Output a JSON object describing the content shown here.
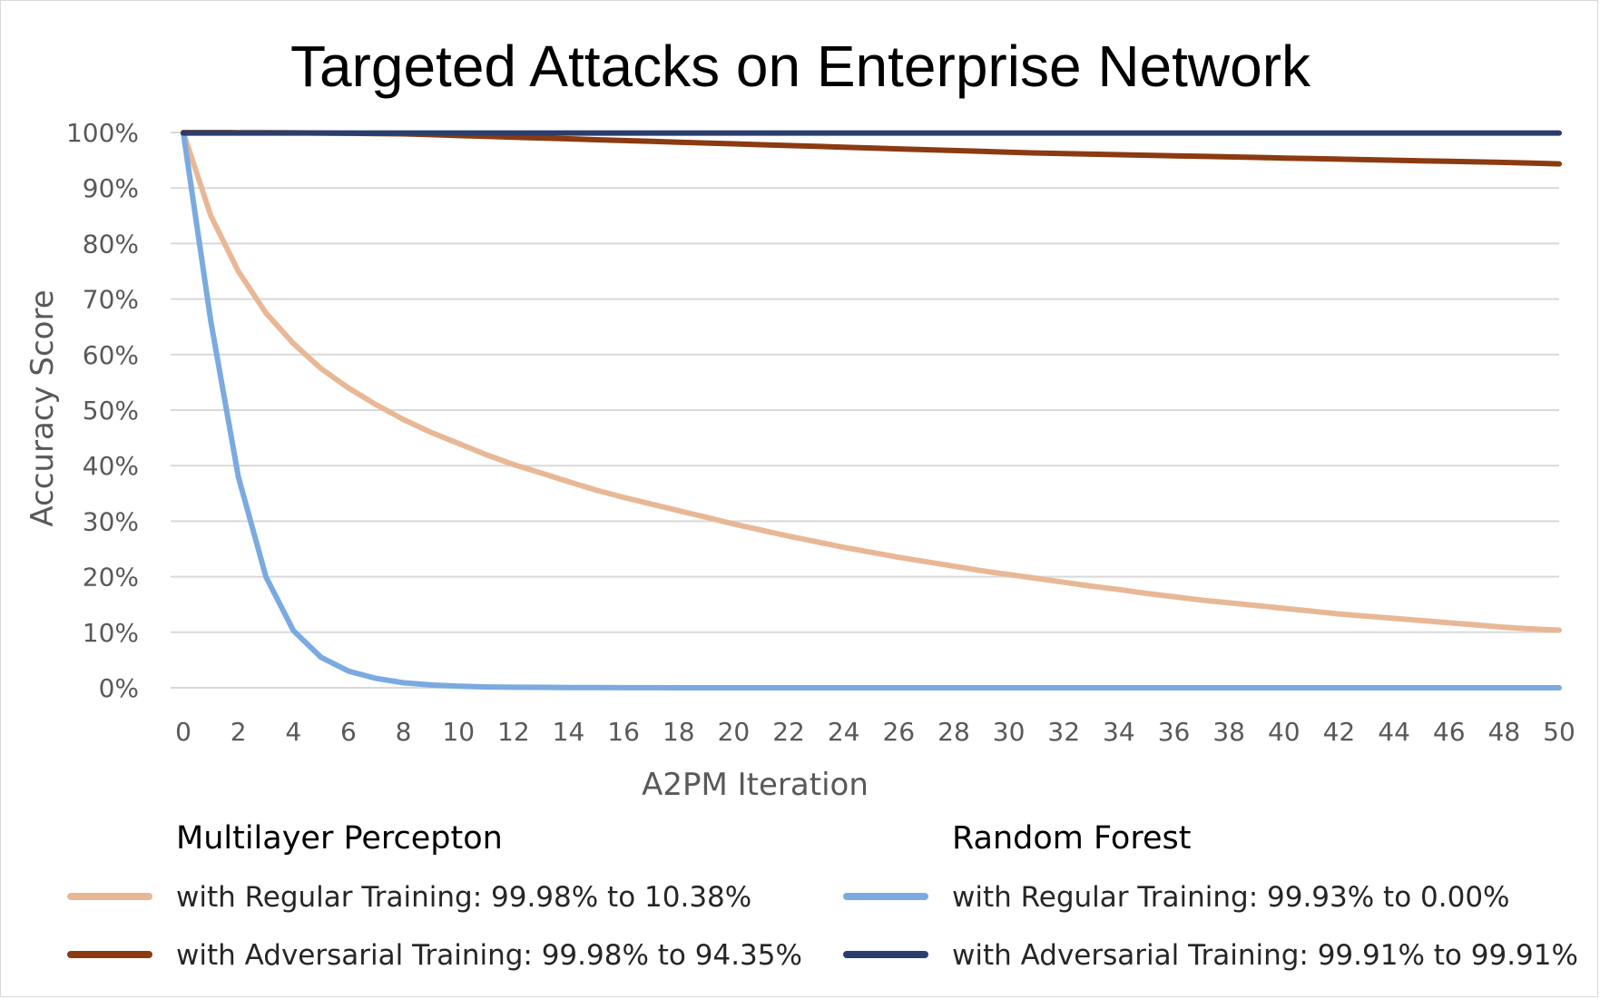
{
  "chart_data": {
    "type": "line",
    "title": "Targeted Attacks on Enterprise Network",
    "xlabel": "A2PM Iteration",
    "ylabel": "Accuracy Score",
    "xlim": [
      0,
      50
    ],
    "ylim": [
      0,
      100
    ],
    "x_ticks": [
      "0",
      "2",
      "4",
      "6",
      "8",
      "10",
      "12",
      "14",
      "16",
      "18",
      "20",
      "22",
      "24",
      "26",
      "28",
      "30",
      "32",
      "34",
      "36",
      "38",
      "40",
      "42",
      "44",
      "46",
      "48",
      "50"
    ],
    "y_ticks": [
      "0%",
      "10%",
      "20%",
      "30%",
      "40%",
      "50%",
      "60%",
      "70%",
      "80%",
      "90%",
      "100%"
    ],
    "grid": true,
    "legend_position": "bottom",
    "legend_groups": [
      {
        "title": "Multilayer Percepton",
        "entries": [
          {
            "label": "with Regular Training:  99.98% to 10.38%",
            "series_index": 0
          },
          {
            "label": "with Adversarial Training:  99.98% to 94.35%",
            "series_index": 1
          }
        ]
      },
      {
        "title": "Random Forest",
        "entries": [
          {
            "label": "with Regular Training:  99.93% to 0.00%",
            "series_index": 2
          },
          {
            "label": "with Adversarial Training:  99.91% to 99.91%",
            "series_index": 3
          }
        ]
      }
    ],
    "x": [
      0,
      1,
      2,
      3,
      4,
      5,
      6,
      7,
      8,
      9,
      10,
      11,
      12,
      13,
      14,
      15,
      16,
      17,
      18,
      19,
      20,
      21,
      22,
      23,
      24,
      25,
      26,
      27,
      28,
      29,
      30,
      31,
      32,
      33,
      34,
      35,
      36,
      37,
      38,
      39,
      40,
      41,
      42,
      43,
      44,
      45,
      46,
      47,
      48,
      49,
      50
    ],
    "series": [
      {
        "color": "#e8b896",
        "values": [
          99.98,
          85,
          75,
          67.5,
          62,
          57.5,
          54,
          51,
          48.3,
          46,
          44,
          42,
          40.2,
          38.7,
          37.1,
          35.6,
          34.3,
          33.1,
          31.9,
          30.7,
          29.5,
          28.4,
          27.3,
          26.3,
          25.3,
          24.4,
          23.5,
          22.7,
          21.9,
          21.1,
          20.4,
          19.7,
          19.0,
          18.3,
          17.7,
          17.0,
          16.4,
          15.8,
          15.3,
          14.8,
          14.3,
          13.8,
          13.3,
          12.9,
          12.5,
          12.1,
          11.7,
          11.3,
          10.9,
          10.6,
          10.38
        ]
      },
      {
        "color": "#8b3a12",
        "values": [
          99.98,
          99.98,
          99.97,
          99.95,
          99.93,
          99.9,
          99.85,
          99.8,
          99.75,
          99.6,
          99.45,
          99.3,
          99.15,
          99.0,
          98.85,
          98.7,
          98.55,
          98.4,
          98.25,
          98.1,
          97.95,
          97.8,
          97.65,
          97.5,
          97.35,
          97.2,
          97.05,
          96.9,
          96.75,
          96.6,
          96.45,
          96.3,
          96.2,
          96.1,
          96.0,
          95.9,
          95.8,
          95.7,
          95.6,
          95.5,
          95.4,
          95.3,
          95.2,
          95.1,
          95.0,
          94.9,
          94.8,
          94.7,
          94.6,
          94.5,
          94.35
        ]
      },
      {
        "color": "#7aaadf",
        "values": [
          99.93,
          66,
          38,
          20,
          10.3,
          5.5,
          3.0,
          1.7,
          0.9,
          0.5,
          0.3,
          0.15,
          0.1,
          0.08,
          0.05,
          0.03,
          0.02,
          0.01,
          0.0,
          0.0,
          0.0,
          0.0,
          0.0,
          0.0,
          0.0,
          0.0,
          0.0,
          0.0,
          0.0,
          0.0,
          0.0,
          0.0,
          0.0,
          0.0,
          0.0,
          0.0,
          0.0,
          0.0,
          0.0,
          0.0,
          0.0,
          0.0,
          0.0,
          0.0,
          0.0,
          0.0,
          0.0,
          0.0,
          0.0,
          0.0,
          0.0
        ]
      },
      {
        "color": "#2a3e6e",
        "values": [
          99.91,
          99.91,
          99.91,
          99.91,
          99.91,
          99.91,
          99.91,
          99.91,
          99.91,
          99.91,
          99.91,
          99.91,
          99.91,
          99.91,
          99.91,
          99.91,
          99.91,
          99.91,
          99.91,
          99.91,
          99.91,
          99.91,
          99.91,
          99.91,
          99.91,
          99.91,
          99.91,
          99.91,
          99.91,
          99.91,
          99.91,
          99.91,
          99.91,
          99.91,
          99.91,
          99.91,
          99.91,
          99.91,
          99.91,
          99.91,
          99.91,
          99.91,
          99.91,
          99.91,
          99.91,
          99.91,
          99.91,
          99.91,
          99.91,
          99.91,
          99.91
        ]
      }
    ],
    "gridline_color": "#d9d9d9"
  }
}
